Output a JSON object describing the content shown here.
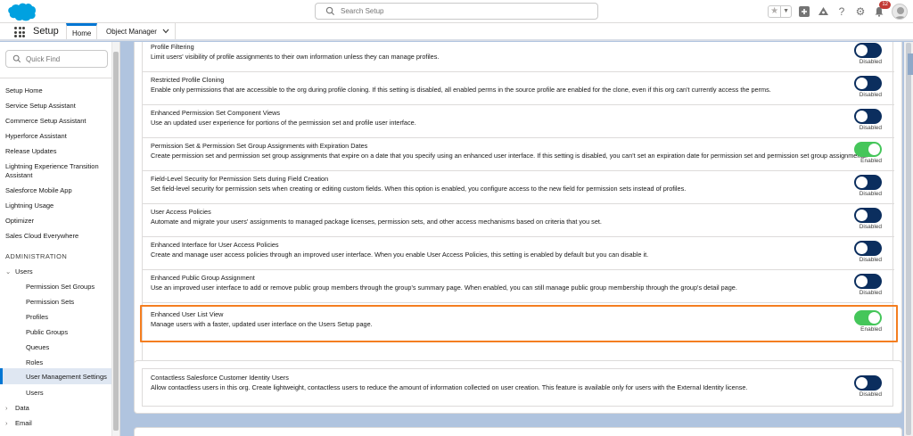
{
  "header": {
    "search_placeholder": "Search Setup",
    "notifications_count": "12"
  },
  "nav": {
    "app_name": "Setup",
    "tabs": [
      {
        "label": "Home"
      },
      {
        "label": "Object Manager"
      }
    ]
  },
  "sidebar": {
    "quickfind_placeholder": "Quick Find",
    "items": [
      "Setup Home",
      "Service Setup Assistant",
      "Commerce Setup Assistant",
      "Hyperforce Assistant",
      "Release Updates",
      "Lightning Experience Transition",
      "Assistant",
      "Salesforce Mobile App",
      "Lightning Usage",
      "Optimizer",
      "Sales Cloud Everywhere"
    ],
    "section_header": "ADMINISTRATION",
    "users_group": "Users",
    "users_children": [
      "Permission Set Groups",
      "Permission Sets",
      "Profiles",
      "Public Groups",
      "Queues",
      "Roles",
      "User Management Settings",
      "Users"
    ],
    "data_group": "Data",
    "email_group": "Email"
  },
  "settings": [
    {
      "title": "Profile Filtering",
      "desc": "Limit users' visibility of profile assignments to their own information unless they can manage profiles.",
      "status": "Disabled"
    },
    {
      "title": "Restricted Profile Cloning",
      "desc": "Enable only permissions that are accessible to the org during profile cloning. If this setting is disabled, all enabled perms in the source profile are enabled for the clone, even if this org can't currently access the perms.",
      "status": "Disabled"
    },
    {
      "title": "Enhanced Permission Set Component Views",
      "desc": "Use an updated user experience for portions of the permission set and profile user interface.",
      "status": "Disabled"
    },
    {
      "title": "Permission Set & Permission Set Group Assignments with Expiration Dates",
      "desc": "Create permission set and permission set group assignments that expire on a date that you specify using an enhanced user interface. If this setting is disabled, you can't set an expiration date for permission set and permission set group assignments.",
      "status": "Enabled"
    },
    {
      "title": "Field-Level Security for Permission Sets during Field Creation",
      "desc": "Set field-level security for permission sets when creating or editing custom fields. When this option is enabled, you configure access to the new field for permission sets instead of profiles.",
      "status": "Disabled"
    },
    {
      "title": "User Access Policies",
      "desc": "Automate and migrate your users' assignments to managed package licenses, permission sets, and other access mechanisms based on criteria that you set.",
      "status": "Disabled"
    },
    {
      "title": "Enhanced Interface for User Access Policies",
      "desc": "Create and manage user access policies through an improved user interface. When you enable User Access Policies, this setting is enabled by default but you can disable it.",
      "status": "Disabled"
    },
    {
      "title": "Enhanced Public Group Assignment",
      "desc": "Use an improved user interface to add or remove public group members through the group's summary page. When enabled, you can still manage public group membership through the group's detail page.",
      "status": "Disabled"
    },
    {
      "title": "Enhanced User List View",
      "desc": "Manage users with a faster, updated user interface on the Users Setup page.",
      "status": "Enabled"
    }
  ],
  "settings2": [
    {
      "title": "Contactless Salesforce Customer Identity Users",
      "desc": "Allow contactless users in this org. Create lightweight, contactless users to reduce the amount of information collected on user creation. This feature is available only for users with the External Identity license.",
      "status": "Disabled"
    }
  ],
  "colors": {
    "toggle_on": "#45c65a",
    "toggle_off": "#0b2e5e",
    "highlight": "#f47e20",
    "brand": "#0176d3"
  }
}
